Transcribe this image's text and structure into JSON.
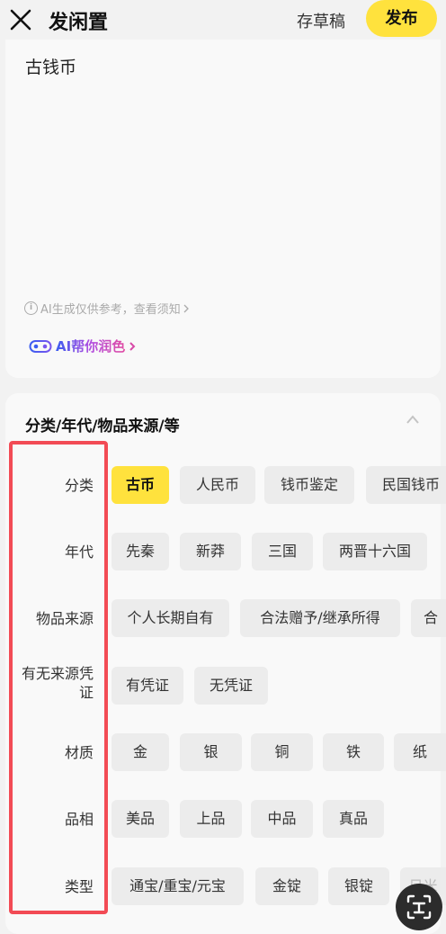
{
  "header": {
    "title": "发闲置",
    "draft_label": "存草稿",
    "publish_label": "发布"
  },
  "description": {
    "text": "古钱币",
    "ai_hint": "AI生成仅供参考，查看须知",
    "ai_polish_label": "AI帮你润色"
  },
  "attributes": {
    "section_title": "分类/年代/物品来源/等",
    "rows": [
      {
        "label": "分类",
        "options": [
          "古币",
          "人民币",
          "钱币鉴定",
          "民国钱币"
        ],
        "selected": 0
      },
      {
        "label": "年代",
        "options": [
          "先秦",
          "新莽",
          "三国",
          "两晋十六国"
        ]
      },
      {
        "label": "物品来源",
        "options": [
          "个人长期自有",
          "合法赠予/继承所得",
          "合"
        ]
      },
      {
        "label_line1": "有无来源凭",
        "label_line2": "证",
        "options": [
          "有凭证",
          "无凭证"
        ]
      },
      {
        "label": "材质",
        "options": [
          "金",
          "银",
          "铜",
          "铁",
          "纸"
        ]
      },
      {
        "label": "品相",
        "options": [
          "美品",
          "上品",
          "中品",
          "真品"
        ]
      },
      {
        "label": "类型",
        "options": [
          "通宝/重宝/元宝",
          "金锭",
          "银锭",
          "日米"
        ]
      }
    ]
  },
  "colors": {
    "accent": "#ffe23d",
    "highlight_border": "#f24b55",
    "chip_bg": "#ececec",
    "page_bg": "#f2f2f2",
    "card_bg": "#f9f9f9"
  },
  "icons": {
    "close": "close-icon",
    "collapse": "chevron-up-icon",
    "ai": "ai-logo-icon",
    "scan": "scan-text-icon",
    "info": "info-icon"
  }
}
